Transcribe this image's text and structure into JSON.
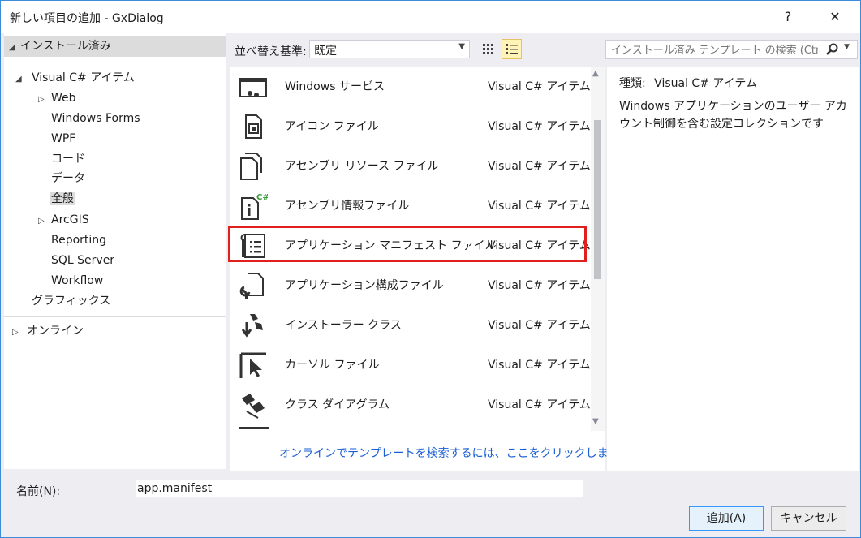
{
  "window": {
    "title": "新しい項目の追加 - GxDialog",
    "help_label": "?",
    "close_label": "✕"
  },
  "tree": {
    "installed": "インストール済み",
    "visual_csharp": "Visual C# アイテム",
    "children": [
      "Web",
      "Windows Forms",
      "WPF",
      "コード",
      "データ",
      "全般",
      "ArcGIS",
      "Reporting",
      "SQL Server",
      "Workflow"
    ],
    "graphics": "グラフィックス",
    "online": "オンライン"
  },
  "sortbar": {
    "label": "並べ替え基準:",
    "value": "既定"
  },
  "search": {
    "placeholder": "インストール済み テンプレート の検索 (Ctrl+E)"
  },
  "templates": [
    {
      "name": "Windows サービス",
      "lang": "Visual C# アイテム",
      "icon": "windows-service-icon"
    },
    {
      "name": "アイコン ファイル",
      "lang": "Visual C# アイテム",
      "icon": "icon-file-icon"
    },
    {
      "name": "アセンブリ リソース ファイル",
      "lang": "Visual C# アイテム",
      "icon": "resource-file-icon"
    },
    {
      "name": "アセンブリ情報ファイル",
      "lang": "Visual C# アイテム",
      "icon": "assembly-info-icon"
    },
    {
      "name": "アプリケーション マニフェスト ファイル",
      "lang": "Visual C# アイテム",
      "icon": "manifest-icon"
    },
    {
      "name": "アプリケーション構成ファイル",
      "lang": "Visual C# アイテム",
      "icon": "config-file-icon"
    },
    {
      "name": "インストーラー クラス",
      "lang": "Visual C# アイテム",
      "icon": "installer-class-icon"
    },
    {
      "name": "カーソル ファイル",
      "lang": "Visual C# アイテム",
      "icon": "cursor-file-icon"
    },
    {
      "name": "クラス ダイアグラム",
      "lang": "Visual C# アイテム",
      "icon": "class-diagram-icon"
    }
  ],
  "online_link": "オンラインでテンプレートを検索するには、ここをクリックします。",
  "detail": {
    "type_label": "種類:",
    "type_value": "Visual C# アイテム",
    "description": "Windows アプリケーションのユーザー アカウント制御を含む設定コレクションです"
  },
  "footer": {
    "name_label": "名前(N):",
    "name_value": "app.manifest",
    "add_button": "追加(A)",
    "cancel_button": "キャンセル"
  },
  "colors": {
    "highlight_border": "#e0201e",
    "link": "#1a5fd6",
    "dialog_border": "#3c8ad8"
  }
}
